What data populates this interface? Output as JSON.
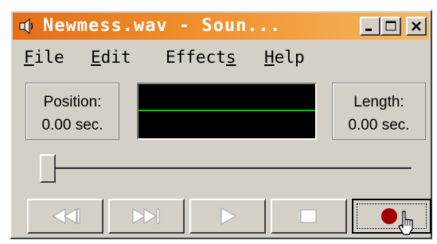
{
  "window": {
    "title": "Newmess.wav - Soun...",
    "app_icon": "speaker-icon",
    "controls": [
      "minimize-icon",
      "maximize-icon",
      "close-icon"
    ]
  },
  "menu": {
    "file": {
      "key": "F",
      "rest": "ile"
    },
    "edit": {
      "key": "E",
      "rest": "dit"
    },
    "effects": {
      "pre": "Effect",
      "key": "s"
    },
    "help": {
      "key": "H",
      "rest": "elp"
    }
  },
  "position": {
    "label": "Position:",
    "value": "0.00 sec."
  },
  "length": {
    "label": "Length:",
    "value": "0.00 sec."
  },
  "slider": {
    "position_fraction": 0.0
  },
  "transport": {
    "icons": [
      "rewind-icon",
      "fast-forward-icon",
      "play-icon",
      "stop-icon",
      "record-icon"
    ],
    "enabled": {
      "rewind": false,
      "fast_forward": false,
      "play": false,
      "stop": false,
      "record": true
    }
  },
  "colors": {
    "titlebar_start": "#e46f18",
    "titlebar_end": "#f6b860",
    "window_face": "#d4d0c8",
    "waveform_bg": "#000000",
    "waveform_line": "#00d000",
    "record_dot": "#a00000",
    "disabled_glyph": "#ffffff"
  }
}
